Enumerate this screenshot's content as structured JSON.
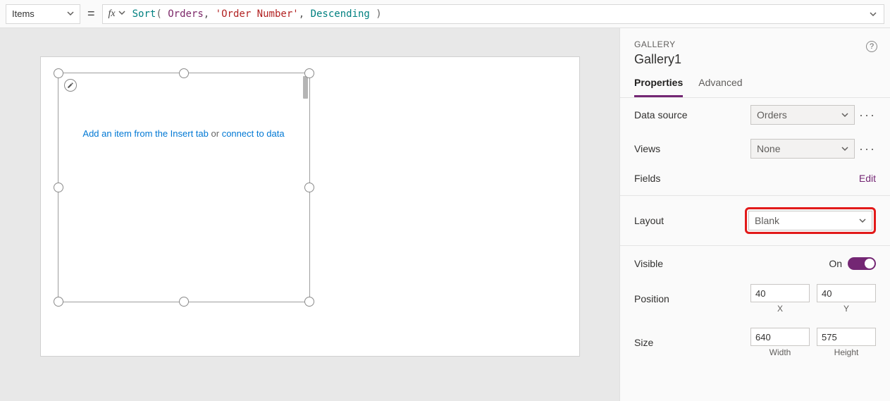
{
  "formula": {
    "property": "Items",
    "equals": "=",
    "fx_label": "fx",
    "tokens": {
      "func": "Sort",
      "open": "(",
      "arg1": "Orders",
      "comma1": ",",
      "arg2": "'Order Number'",
      "comma2": ",",
      "arg3": "Descending",
      "close": ")"
    }
  },
  "canvas": {
    "placeholder_link1": "Add an item from the Insert tab",
    "placeholder_or": " or ",
    "placeholder_link2": "connect to data"
  },
  "panel": {
    "kind": "GALLERY",
    "name": "Gallery1",
    "tabs": {
      "properties": "Properties",
      "advanced": "Advanced"
    },
    "dataSource": {
      "label": "Data source",
      "value": "Orders"
    },
    "views": {
      "label": "Views",
      "value": "None"
    },
    "fields": {
      "label": "Fields",
      "edit": "Edit"
    },
    "layout": {
      "label": "Layout",
      "value": "Blank"
    },
    "visible": {
      "label": "Visible",
      "state": "On"
    },
    "position": {
      "label": "Position",
      "x": "40",
      "y": "40",
      "xLabel": "X",
      "yLabel": "Y"
    },
    "size": {
      "label": "Size",
      "w": "640",
      "h": "575",
      "wLabel": "Width",
      "hLabel": "Height"
    }
  }
}
